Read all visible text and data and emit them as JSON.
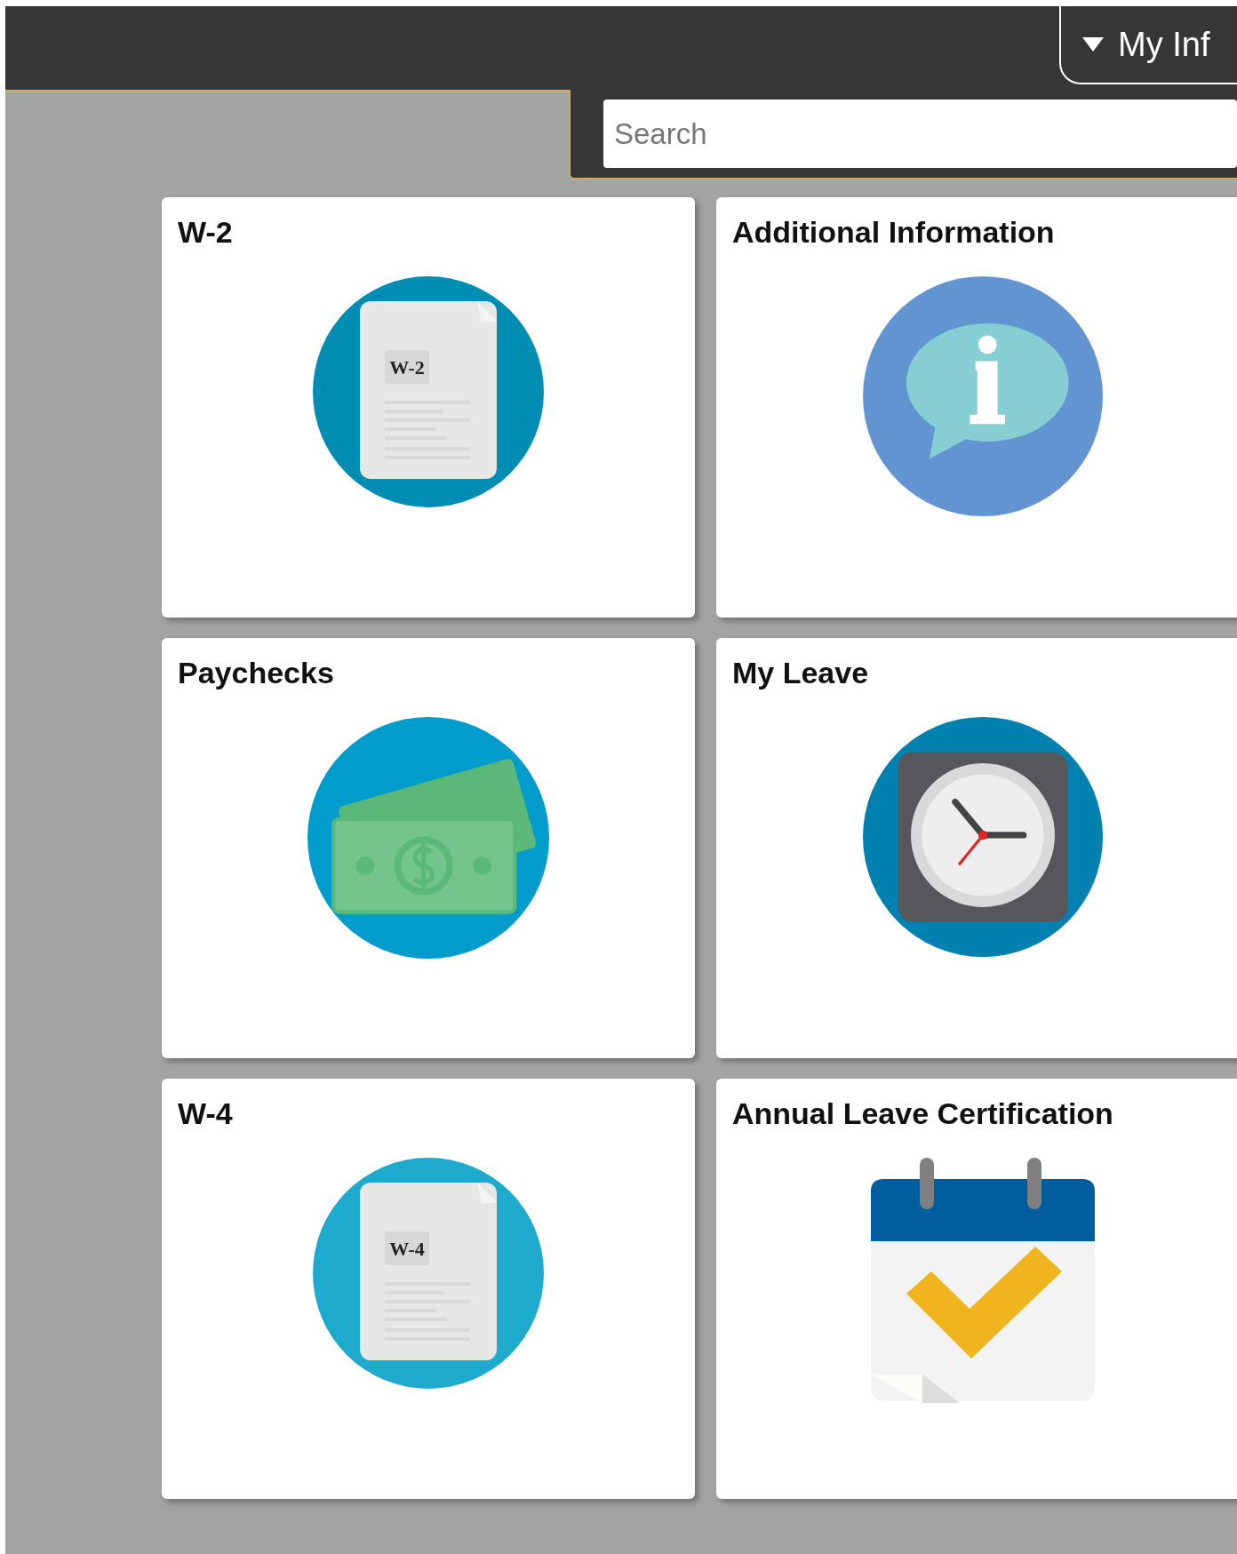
{
  "header": {
    "menu_tab": {
      "label": "My Inf"
    }
  },
  "search": {
    "placeholder": "Search"
  },
  "tiles": [
    {
      "title": "W-2",
      "kind": "document",
      "color": "#008db4",
      "doc_label": "W-2"
    },
    {
      "title": "Additional Information",
      "kind": "info",
      "color": "#6194d0"
    },
    {
      "title": "Paychecks",
      "kind": "money",
      "color": "#009ccc"
    },
    {
      "title": "My Leave",
      "kind": "clock",
      "color": "#0081b0"
    },
    {
      "title": "W-4",
      "kind": "document",
      "color": "#1eaacd",
      "doc_label": "W-4"
    },
    {
      "title": "Annual Leave Certification",
      "kind": "calendar"
    }
  ]
}
